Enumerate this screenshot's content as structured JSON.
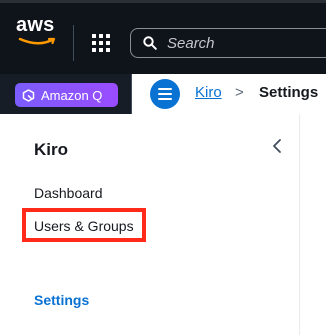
{
  "header": {
    "logo_text": "aws",
    "search_placeholder": "Search"
  },
  "subbar": {
    "amazon_q_label": "Amazon Q",
    "breadcrumb": {
      "root": "Kiro",
      "separator": ">",
      "current": "Settings"
    }
  },
  "side_nav": {
    "title": "Kiro",
    "collapse_icon": "chevron-left-icon",
    "items": [
      {
        "label": "Dashboard"
      },
      {
        "label": "Users & Groups"
      },
      {
        "label": "Settings",
        "active": true
      }
    ]
  },
  "colors": {
    "header_bg": "#0f141a",
    "subbar_bg": "#161d26",
    "link_blue": "#0972d3",
    "amazon_q_start": "#7b5cff",
    "amazon_q_end": "#9a4cff",
    "highlight_red": "#ff2a1a"
  }
}
